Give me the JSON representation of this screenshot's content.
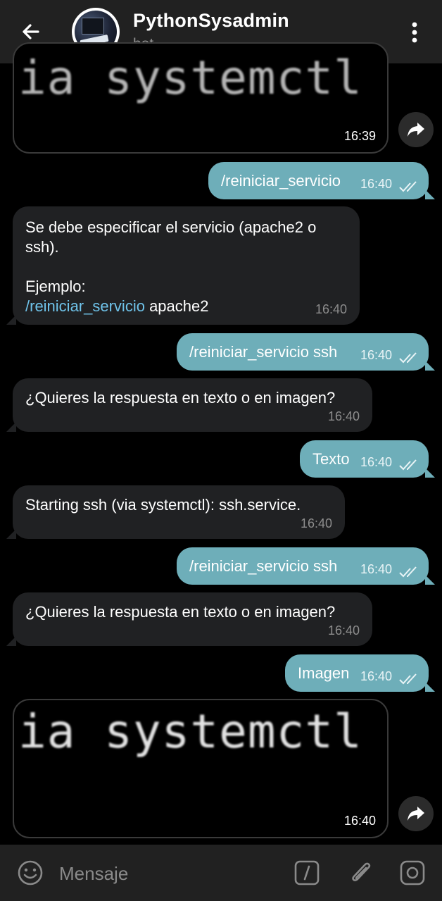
{
  "header": {
    "title": "PythonSysadmin",
    "subtitle": "bot"
  },
  "messages": [
    {
      "type": "image",
      "time": "16:39"
    },
    {
      "type": "out",
      "text": "/reiniciar_servicio",
      "time": "16:40"
    },
    {
      "type": "in",
      "line1": "Se debe especificar el servicio (apache2 o",
      "line2": "ssh).",
      "line3": "Ejemplo:",
      "command": "/reiniciar_servicio",
      "arg": " apache2",
      "time": "16:40"
    },
    {
      "type": "out",
      "text": "/reiniciar_servicio ssh",
      "time": "16:40"
    },
    {
      "type": "in",
      "text": "¿Quieres la respuesta en texto o en imagen?",
      "time": "16:40"
    },
    {
      "type": "out",
      "text": "Texto",
      "time": "16:40"
    },
    {
      "type": "in",
      "text": "Starting ssh (via systemctl): ssh.service.",
      "time": "16:40"
    },
    {
      "type": "out",
      "text": "/reiniciar_servicio ssh",
      "time": "16:40"
    },
    {
      "type": "in",
      "text": "¿Quieres la respuesta en texto o en imagen?",
      "time": "16:40"
    },
    {
      "type": "out",
      "text": "Imagen",
      "time": "16:40"
    },
    {
      "type": "image",
      "image_text": "ia systemctl",
      "time": "16:40"
    }
  ],
  "input": {
    "placeholder": "Mensaje"
  },
  "icons": {
    "back": "arrow-left-icon",
    "menu": "more-vertical-icon",
    "share": "share-icon",
    "emoji": "emoji-icon",
    "commands": "slash-command-icon",
    "attach": "paperclip-icon",
    "camera": "camera-icon"
  },
  "colors": {
    "header_bg": "#212121",
    "chat_bg": "#000000",
    "incoming_bubble": "#202123",
    "outgoing_bubble": "#6eaeb9",
    "link": "#6fc3ea"
  }
}
